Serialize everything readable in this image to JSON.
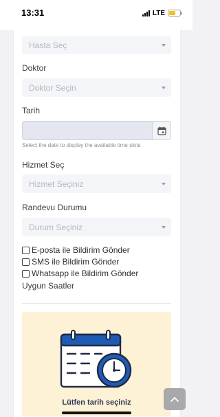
{
  "status_bar": {
    "time": "13:31",
    "network": "LTE",
    "battery_level": 0.6,
    "battery_color": "#f4c21b"
  },
  "form": {
    "patient_select": {
      "placeholder": "Hasta Seç"
    },
    "doctor": {
      "label": "Doktor",
      "placeholder": "Doktor Seçin"
    },
    "date": {
      "label": "Tarih",
      "value": "",
      "hint": "Select the date to display the available time slots"
    },
    "service": {
      "label": "Hizmet Seç",
      "placeholder": "Hizmet Seçiniz"
    },
    "status": {
      "label": "Randevu Durumu",
      "placeholder": "Durum Seçiniz"
    },
    "notifications": [
      {
        "label": "E-posta ile Bildirim Gönder",
        "checked": false
      },
      {
        "label": "SMS ile Bildirim Gönder",
        "checked": false
      },
      {
        "label": "Whatsapp ile Bildirim Gönder",
        "checked": false
      }
    ],
    "available_slots_label": "Uygun Saatler",
    "empty_state_text": "Lütfen tarih seçiniz"
  },
  "icons": {
    "calendar": "calendar-icon",
    "empty_state": "calendar-clock-icon",
    "scroll_top": "chevron-up-icon"
  },
  "colors": {
    "accent_blue": "#1f5bb5",
    "panel_bg": "#fdf1d6",
    "input_bg": "#f4f5f8"
  }
}
